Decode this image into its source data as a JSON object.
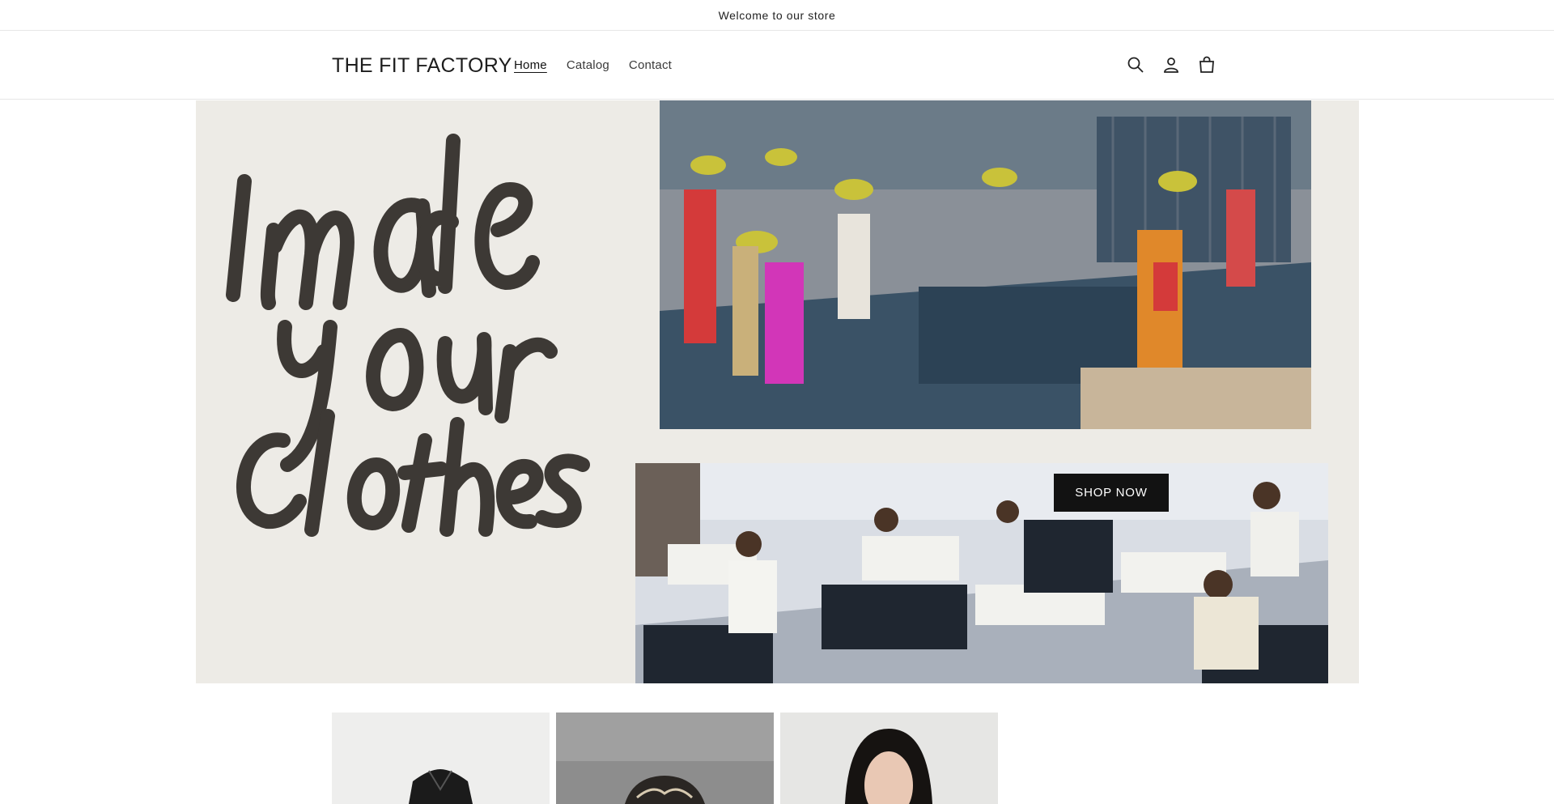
{
  "announcement": {
    "text": "Welcome to our store"
  },
  "header": {
    "logo": "THE FIT FACTORY",
    "nav": [
      {
        "label": "Home",
        "active": true
      },
      {
        "label": "Catalog",
        "active": false
      },
      {
        "label": "Contact",
        "active": false
      }
    ],
    "icons": [
      "search-icon",
      "account-icon",
      "cart-icon"
    ]
  },
  "hero": {
    "button_label": "SHOP NOW",
    "colors": {
      "background": "#edebe6",
      "button": "#121212",
      "scrawl": "#3d3935"
    }
  },
  "products": {
    "cards": [
      {
        "image": "leather-jacket"
      },
      {
        "image": "patterned-garment"
      },
      {
        "image": "woman-portrait"
      }
    ]
  }
}
